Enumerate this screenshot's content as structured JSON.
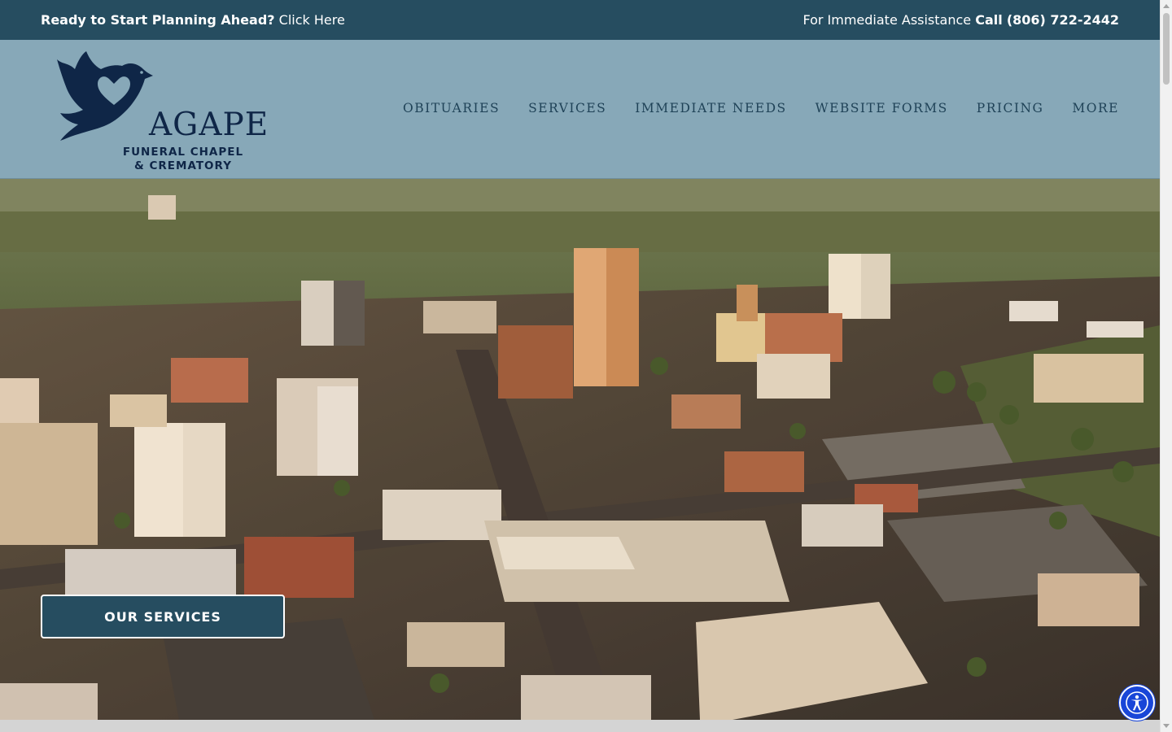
{
  "topbar": {
    "planning_prompt": "Ready to Start Planning Ahead?",
    "planning_link": "Click Here",
    "assistance_text": "For Immediate Assistance",
    "call_label": "Call",
    "phone": "(806) 722-2442"
  },
  "logo": {
    "wordmark": "AGAPE",
    "line1": "FUNERAL CHAPEL",
    "line2": "& CREMATORY",
    "color": "#0f2647"
  },
  "nav": {
    "items": [
      "OBITUARIES",
      "SERVICES",
      "IMMEDIATE NEEDS",
      "WEBSITE FORMS",
      "PRICING",
      "MORE"
    ]
  },
  "hero": {
    "button_label": "OUR SERVICES",
    "image": "aerial-city-skyline"
  },
  "colors": {
    "topbar_bg": "#264d60",
    "header_bg": "#87a8b8",
    "nav_text": "#1f4257",
    "button_bg": "#264d60",
    "accessibility_button": "#1946d8"
  },
  "icons": {
    "logo_mark": "dove-heart-icon",
    "accessibility": "accessibility-icon"
  }
}
